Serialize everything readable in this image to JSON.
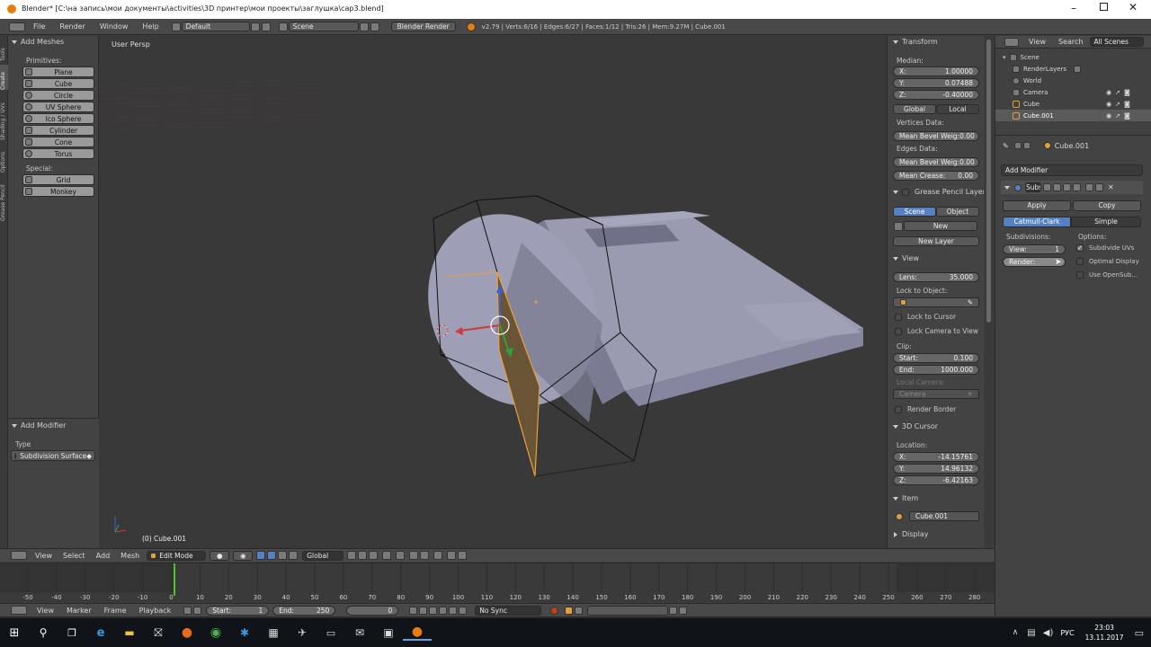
{
  "window": {
    "title": "Blender* [C:\\на запись\\мои документы\\activities\\3D принтер\\мои проекты\\заглушка\\cap3.blend]"
  },
  "info_header": {
    "menus": [
      "File",
      "Render",
      "Window",
      "Help"
    ],
    "screen_layout": "Default",
    "scene": "Scene",
    "engine": "Blender Render",
    "stats": "v2.79 | Verts:6/16 | Edges:6/27 | Faces:1/12 | Tris:26 | Mem:9.27M | Cube.001"
  },
  "tool_shelf": {
    "tabs": [
      "Tools",
      "Create",
      "Shading / UVs",
      "Options",
      "Grease Pencil"
    ],
    "panel_title": "Add Meshes",
    "primitives_label": "Primitives:",
    "primitives": [
      "Plane",
      "Cube",
      "Circle",
      "UV Sphere",
      "Ico Sphere",
      "Cylinder",
      "Cone",
      "Torus"
    ],
    "special_label": "Special:",
    "special": [
      "Grid",
      "Monkey"
    ],
    "operator_title": "Add Modifier",
    "type_label": "Type",
    "type_value": "Subdivision Surface"
  },
  "viewport": {
    "view_name": "User Persp",
    "object_label": "(0) Cube.001"
  },
  "properties_n": {
    "transform_title": "Transform",
    "median_label": "Median:",
    "median": [
      {
        "axis": "X:",
        "value": "1.00000"
      },
      {
        "axis": "Y:",
        "value": "0.07488"
      },
      {
        "axis": "Z:",
        "value": "-0.40000"
      }
    ],
    "global_label": "Global",
    "local_label": "Local",
    "vertices_data_label": "Vertices Data:",
    "mean_bevel_vert": {
      "label": "Mean Bevel Weig:",
      "value": "0.00"
    },
    "edges_data_label": "Edges Data:",
    "mean_bevel_edge": {
      "label": "Mean Bevel Weig:",
      "value": "0.00"
    },
    "mean_crease": {
      "label": "Mean Crease:",
      "value": "0.00"
    },
    "grease_title": "Grease Pencil Layers",
    "scene_btn": "Scene",
    "object_btn": "Object",
    "new_btn": "New",
    "new_layer_btn": "New Layer",
    "view_title": "View",
    "lens": {
      "label": "Lens:",
      "value": "35.000"
    },
    "lock_to_object": "Lock to Object:",
    "lock_to_cursor": "Lock to Cursor",
    "lock_camera": "Lock Camera to View",
    "clip_label": "Clip:",
    "clip_start": {
      "label": "Start:",
      "value": "0.100"
    },
    "clip_end": {
      "label": "End:",
      "value": "1000.000"
    },
    "local_camera_label": "Local Camera:",
    "camera_value": "Camera",
    "render_border": "Render Border",
    "cursor_title": "3D Cursor",
    "location_label": "Location:",
    "cursor": [
      {
        "axis": "X:",
        "value": "-14.15761"
      },
      {
        "axis": "Y:",
        "value": "14.96132"
      },
      {
        "axis": "Z:",
        "value": "-6.42163"
      }
    ],
    "item_title": "Item",
    "item_name": "Cube.001",
    "display_title": "Display"
  },
  "outliner": {
    "menus": [
      "View",
      "Search"
    ],
    "filter": "All Scenes",
    "items": [
      {
        "name": "Scene",
        "indent": 0
      },
      {
        "name": "RenderLayers",
        "indent": 1
      },
      {
        "name": "World",
        "indent": 1
      },
      {
        "name": "Camera",
        "indent": 1
      },
      {
        "name": "Cube",
        "indent": 1
      },
      {
        "name": "Cube.001",
        "indent": 1
      }
    ]
  },
  "properties": {
    "object_name": "Cube.001",
    "add_modifier": "Add Modifier",
    "modifier_name": "Subs",
    "apply": "Apply",
    "copy": "Copy",
    "catmull": "Catmull-Clark",
    "simple": "Simple",
    "subdivisions_label": "Subdivisions:",
    "options_label": "Options:",
    "view_field": {
      "label": "View:",
      "value": "1"
    },
    "render_field": {
      "label": "Render:",
      "value": ""
    },
    "subdivide_uvs": "Subdivide UVs",
    "optimal_display": "Optimal Display",
    "use_opensubdiv": "Use OpenSub..."
  },
  "view3d_header": {
    "menus": [
      "View",
      "Select",
      "Add",
      "Mesh"
    ],
    "mode": "Edit Mode",
    "orientation": "Global"
  },
  "timeline": {
    "ticks": [
      "-50",
      "-40",
      "-30",
      "-20",
      "-10",
      "0",
      "10",
      "20",
      "30",
      "40",
      "50",
      "60",
      "70",
      "80",
      "90",
      "100",
      "110",
      "120",
      "130",
      "140",
      "150",
      "160",
      "170",
      "180",
      "190",
      "200",
      "210",
      "220",
      "230",
      "240",
      "250",
      "260",
      "270",
      "280"
    ],
    "current_frame": 0,
    "menus": [
      "View",
      "Marker",
      "Frame",
      "Playback"
    ],
    "start": {
      "label": "Start:",
      "value": "1"
    },
    "end": {
      "label": "End:",
      "value": "250"
    },
    "frame": "0",
    "sync": "No Sync"
  },
  "taskbar": {
    "lang": "РУС",
    "time": "23:03",
    "date": "13.11.2017"
  },
  "colors": {
    "accent": "#5680c2",
    "selected_edge": "#e8a040",
    "taskbar": "#101418"
  }
}
